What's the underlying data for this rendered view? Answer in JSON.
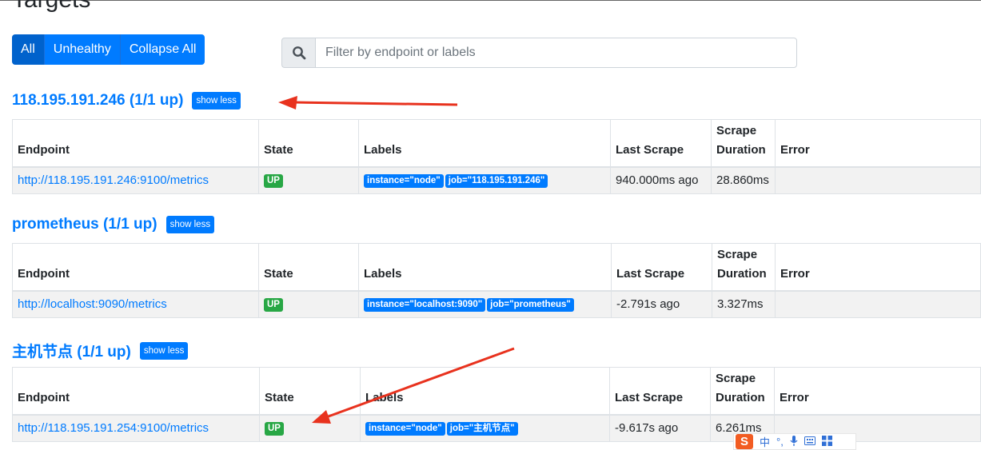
{
  "page": {
    "title": "Targets"
  },
  "filters": {
    "all_label": "All",
    "unhealthy_label": "Unhealthy",
    "collapse_label": "Collapse All"
  },
  "search": {
    "placeholder": "Filter by endpoint or labels",
    "value": ""
  },
  "columns": {
    "endpoint": "Endpoint",
    "state": "State",
    "labels": "Labels",
    "last_scrape": "Last Scrape",
    "scrape_duration_line1": "Scrape",
    "scrape_duration_line2": "Duration",
    "error": "Error"
  },
  "groups": [
    {
      "title": "118.195.191.246 (1/1 up)",
      "toggle": "show less",
      "rows": [
        {
          "endpoint": "http://118.195.191.246:9100/metrics",
          "state": "UP",
          "labels": [
            "instance=\"node\"",
            "job=\"118.195.191.246\""
          ],
          "last_scrape": "940.000ms ago",
          "duration": "28.860ms",
          "error": ""
        }
      ]
    },
    {
      "title": "prometheus (1/1 up)",
      "toggle": "show less",
      "rows": [
        {
          "endpoint": "http://localhost:9090/metrics",
          "state": "UP",
          "labels": [
            "instance=\"localhost:9090\"",
            "job=\"prometheus\""
          ],
          "last_scrape": "-2.791s ago",
          "duration": "3.327ms",
          "error": ""
        }
      ]
    },
    {
      "title": "主机节点 (1/1 up)",
      "toggle": "show less",
      "rows": [
        {
          "endpoint": "http://118.195.191.254:9100/metrics",
          "state": "UP",
          "labels": [
            "instance=\"node\"",
            "job=\"主机节点\""
          ],
          "last_scrape": "-9.617s ago",
          "duration": "6.261ms",
          "error": ""
        }
      ]
    }
  ],
  "ime_toolbar": {
    "logo": "S",
    "mode": "中",
    "punct": "°,",
    "icons": [
      "microphone-icon",
      "keyboard-icon",
      "grid-icon"
    ]
  },
  "colors": {
    "primary": "#007bff",
    "success": "#28a745",
    "annotation_arrow": "#e8321e",
    "ime_logo": "#f25c22"
  }
}
